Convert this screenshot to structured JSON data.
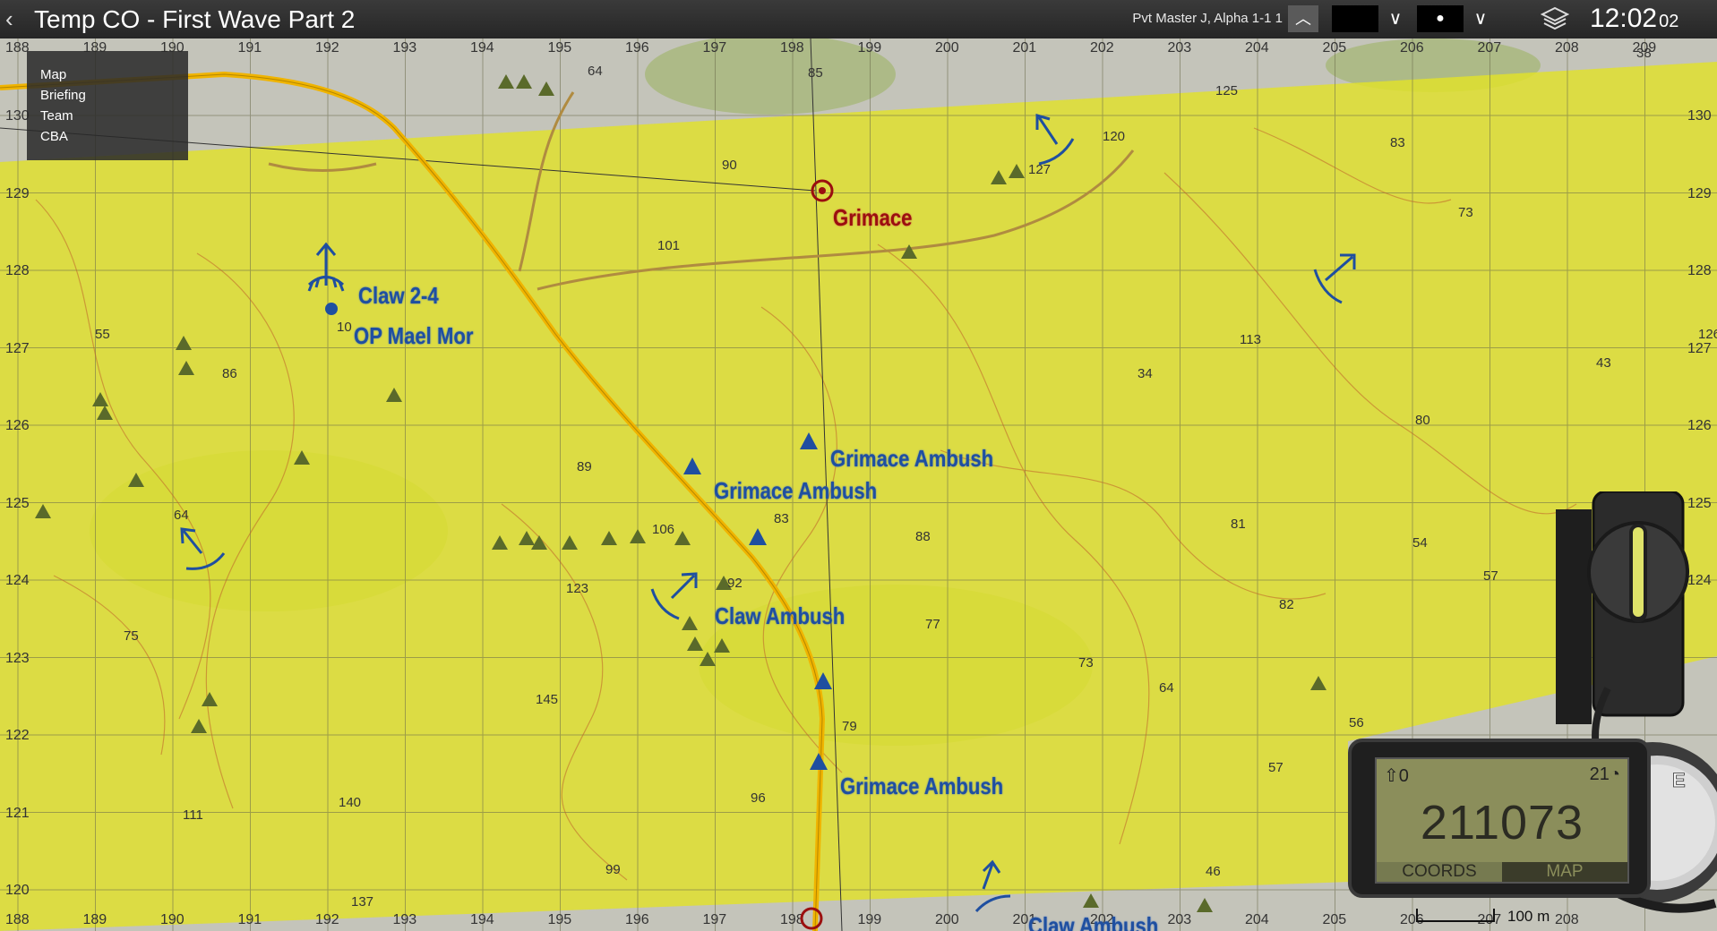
{
  "topbar": {
    "title": "Temp CO - First Wave Part 2",
    "player": "Pvt Master J, Alpha 1-1 1",
    "marker_shape": "●",
    "clock_main": "12:02",
    "clock_seconds": "02"
  },
  "menu": {
    "items": [
      "Map",
      "Briefing",
      "Team",
      "CBA"
    ]
  },
  "map": {
    "colors": {
      "ao_fill": "#e2e22a",
      "road": "#f0b400",
      "marker_blue": "#1f4fa0",
      "marker_red": "#9b0f0f"
    },
    "markers": {
      "grimace": "Grimace",
      "claw_2_4": "Claw 2-4",
      "op_mael_mor": "OP Mael Mor",
      "grimace_ambush": "Grimace Ambush",
      "claw_ambush": "Claw Ambush"
    },
    "grid_top": [
      "188",
      "189",
      "190",
      "191",
      "192",
      "193",
      "194",
      "195",
      "196",
      "197",
      "198",
      "199",
      "200",
      "201",
      "202",
      "203",
      "204",
      "205",
      "206",
      "207",
      "208",
      "209"
    ],
    "grid_bottom": [
      "188",
      "189",
      "190",
      "191",
      "192",
      "193",
      "194",
      "195",
      "196",
      "197",
      "198",
      "199",
      "200",
      "201",
      "202",
      "203",
      "204",
      "205",
      "206",
      "207",
      "208"
    ],
    "grid_left": [
      "130",
      "129",
      "128",
      "127",
      "126",
      "125",
      "124",
      "123",
      "122",
      "121",
      "120"
    ],
    "grid_right": [
      "130",
      "129",
      "128",
      "127",
      "126",
      "125",
      "124"
    ],
    "heights": [
      "64",
      "85",
      "125",
      "38",
      "90",
      "127",
      "120",
      "83",
      "73",
      "101",
      "55",
      "86",
      "113",
      "126",
      "34",
      "43",
      "80",
      "89",
      "83",
      "88",
      "81",
      "54",
      "57",
      "64",
      "106",
      "92",
      "123",
      "75",
      "82",
      "77",
      "73",
      "64",
      "145",
      "79",
      "56",
      "57",
      "111",
      "140",
      "96",
      "99",
      "137",
      "46",
      "10"
    ]
  },
  "gps": {
    "north_icon": "north-arrow-icon",
    "north_value": "0",
    "bearing_value": "21",
    "coords": "211073",
    "tab_coords": "COORDS",
    "tab_map": "MAP"
  },
  "scale": {
    "label": "100 m"
  }
}
